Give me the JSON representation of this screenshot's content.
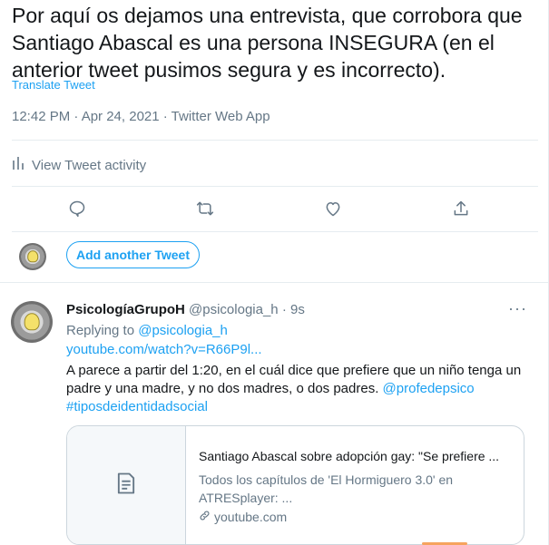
{
  "tweet": {
    "text": "Por aquí os dejamos una entrevista, que corrobora que Santiago Abascal es una persona INSEGURA (en el anterior tweet pusimos segura y es incorrecto).",
    "translate_label": "Translate Tweet",
    "meta": "12:42 PM · Apr 24, 2021 · Twitter Web App",
    "activity_label": "View Tweet activity"
  },
  "compose": {
    "add_button_label": "Add another Tweet"
  },
  "reply": {
    "name": "PsicologíaGrupoH",
    "handle_time": "@psicologia_h · 9s",
    "more": "···",
    "replying_prefix": "Replying to ",
    "replying_handle": "@psicologia_h",
    "link": "youtube.com/watch?v=R66P9l...",
    "body_text": "A parece a partir del 1:20, en el cuál dice que prefiere que un niño tenga un padre y una madre, y no dos madres, o dos padres. ",
    "mention": "@profedepsico",
    "hashtag": "#tiposdeidentidadsocial",
    "card": {
      "title": "Santiago Abascal sobre adopción gay: \"Se prefiere ...",
      "description": "Todos los capítulos de 'El Hormiguero 3.0' en ATRESplayer: ...",
      "domain": "youtube.com"
    }
  },
  "icons": [
    "analytics-icon",
    "reply-icon",
    "retweet-icon",
    "like-icon",
    "share-icon",
    "document-icon",
    "link-icon"
  ],
  "colors": {
    "accent": "#1da1f2",
    "muted": "#657786",
    "text": "#14171a",
    "border": "#e6ecf0"
  }
}
